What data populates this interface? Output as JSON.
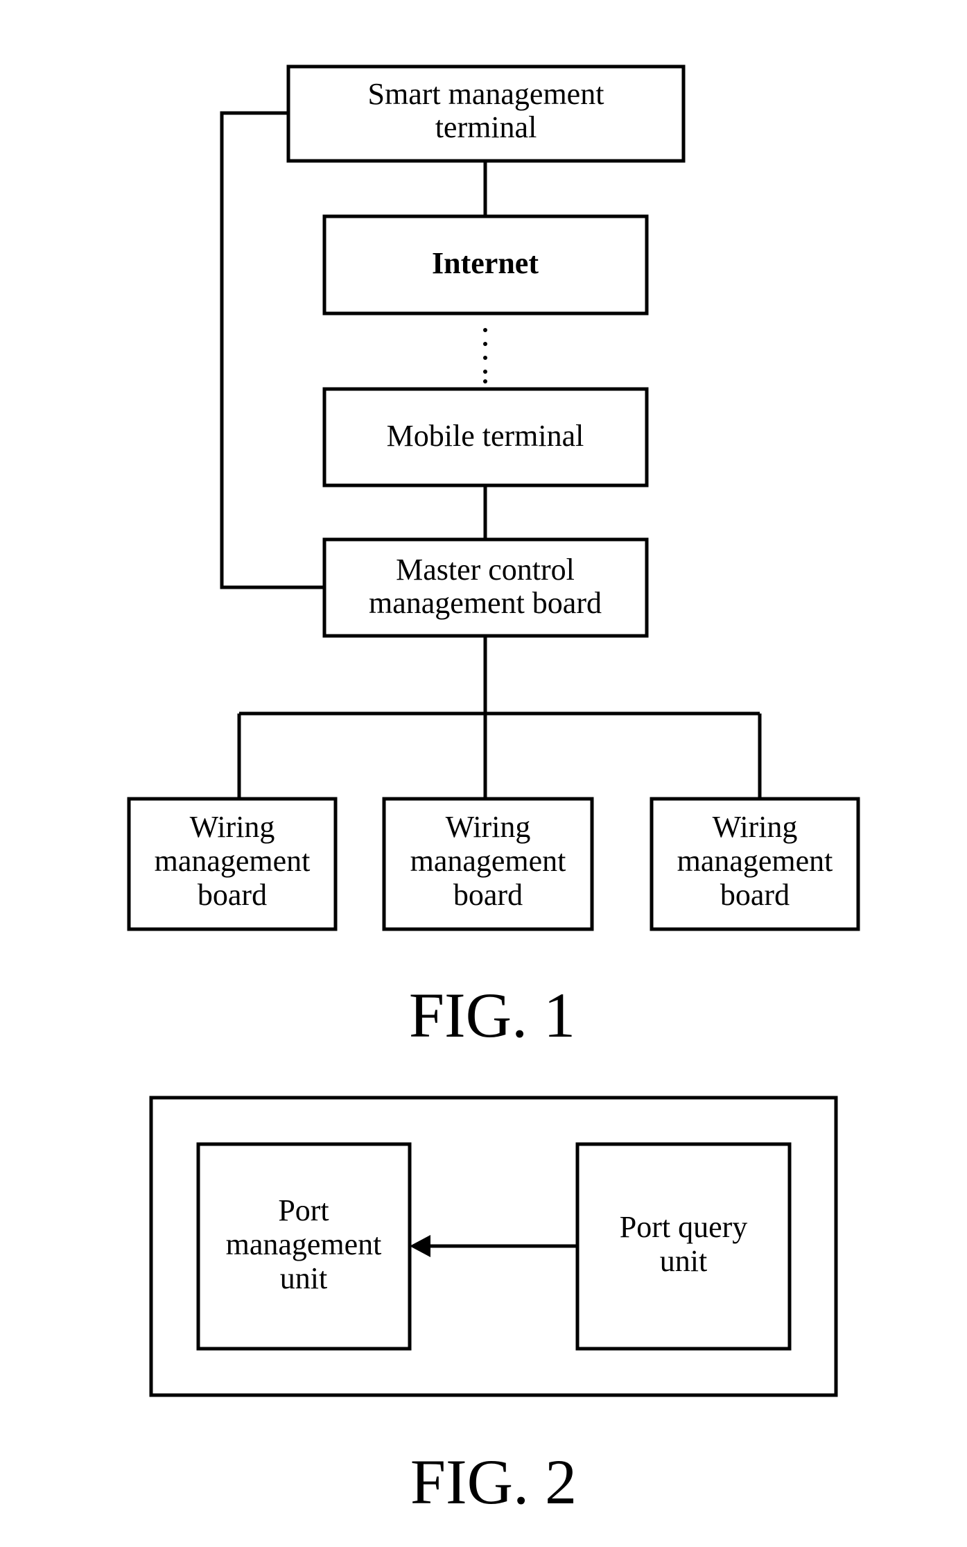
{
  "fig1": {
    "caption": "FIG. 1",
    "smart_terminal": {
      "line1": "Smart management",
      "line2": "terminal"
    },
    "internet": {
      "label": "Internet"
    },
    "mobile_terminal": {
      "label": "Mobile terminal"
    },
    "master_board": {
      "line1": "Master control",
      "line2": "management board"
    },
    "wiring_boards": [
      {
        "line1": "Wiring",
        "line2": "management",
        "line3": "board"
      },
      {
        "line1": "Wiring",
        "line2": "management",
        "line3": "board"
      },
      {
        "line1": "Wiring",
        "line2": "management",
        "line3": "board"
      }
    ]
  },
  "fig2": {
    "caption": "FIG. 2",
    "port_management_unit": {
      "line1": "Port",
      "line2": "management",
      "line3": "unit"
    },
    "port_query_unit": {
      "line1": "Port query",
      "line2": "unit"
    }
  }
}
